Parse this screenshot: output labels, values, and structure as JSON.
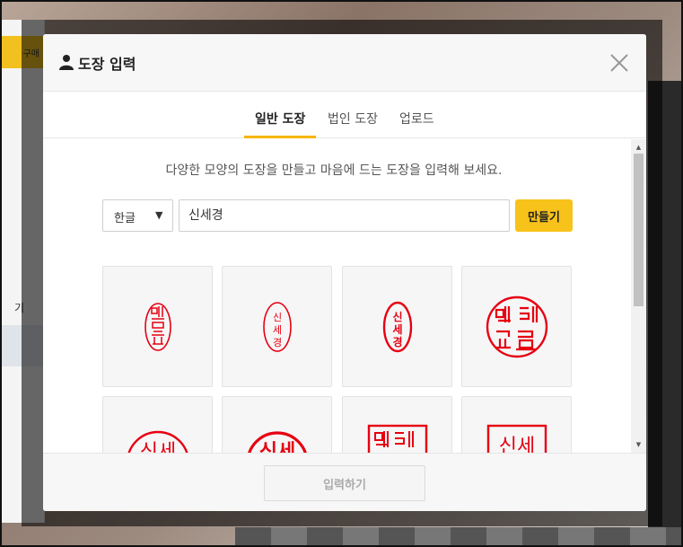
{
  "background": {
    "buy_badge_label": "구매",
    "sidebar_fragment": "기"
  },
  "modal": {
    "title": "도장 입력",
    "title_icon": "user-icon",
    "close_icon": "close-icon",
    "tabs": [
      {
        "label": "일반 도장",
        "active": true
      },
      {
        "label": "법인 도장",
        "active": false
      },
      {
        "label": "업로드",
        "active": false
      }
    ],
    "description": "다양한 모양의 도장을 만들고 마음에 드는 도장을 입력해 보세요.",
    "script_select": {
      "value": "한글",
      "caret": "▼"
    },
    "name_input": {
      "value": "신세경"
    },
    "make_button": "만들기",
    "stamps": [
      {
        "style": "oval-seal-script",
        "text": "신세경"
      },
      {
        "style": "oval-vertical",
        "text": "신세경"
      },
      {
        "style": "oval-bold-vertical",
        "text": "신세경"
      },
      {
        "style": "circle-seal-script",
        "text": "신세경"
      },
      {
        "style": "circle-horizontal",
        "text": "신세경"
      },
      {
        "style": "circle-bold-horizontal",
        "text": "신세경"
      },
      {
        "style": "square-seal-script",
        "text": "신세경"
      },
      {
        "style": "square-horizontal",
        "text": "신세경"
      }
    ],
    "submit_button": "입력하기",
    "accent_color": "#f7c21a",
    "stamp_color": "#e60012"
  }
}
